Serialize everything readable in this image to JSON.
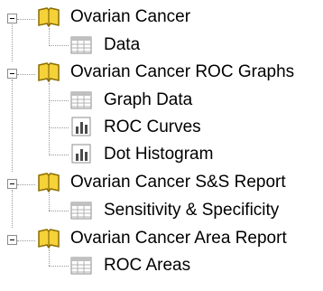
{
  "tree": {
    "groups": [
      {
        "label": "Ovarian Cancer",
        "expander": "minus",
        "icon": "book-icon",
        "children": [
          {
            "label": "Data",
            "icon": "table-icon"
          }
        ]
      },
      {
        "label": "Ovarian Cancer ROC Graphs",
        "expander": "minus",
        "icon": "book-icon",
        "children": [
          {
            "label": "Graph Data",
            "icon": "table-icon"
          },
          {
            "label": "ROC Curves",
            "icon": "chart-icon"
          },
          {
            "label": "Dot Histogram",
            "icon": "chart-icon"
          }
        ]
      },
      {
        "label": "Ovarian Cancer S&S Report",
        "expander": "minus",
        "icon": "book-icon",
        "children": [
          {
            "label": "Sensitivity & Specificity",
            "icon": "table-icon"
          }
        ]
      },
      {
        "label": "Ovarian Cancer Area Report",
        "expander": "minus",
        "icon": "book-icon",
        "children": [
          {
            "label": "ROC Areas",
            "icon": "table-icon"
          }
        ]
      }
    ]
  },
  "colors": {
    "book_cover": "#f6d23a",
    "book_outline": "#8a6d00",
    "table_header": "#c0c0c0",
    "table_line": "#8c8c8c",
    "chart_bar": "#4a4a4a"
  }
}
